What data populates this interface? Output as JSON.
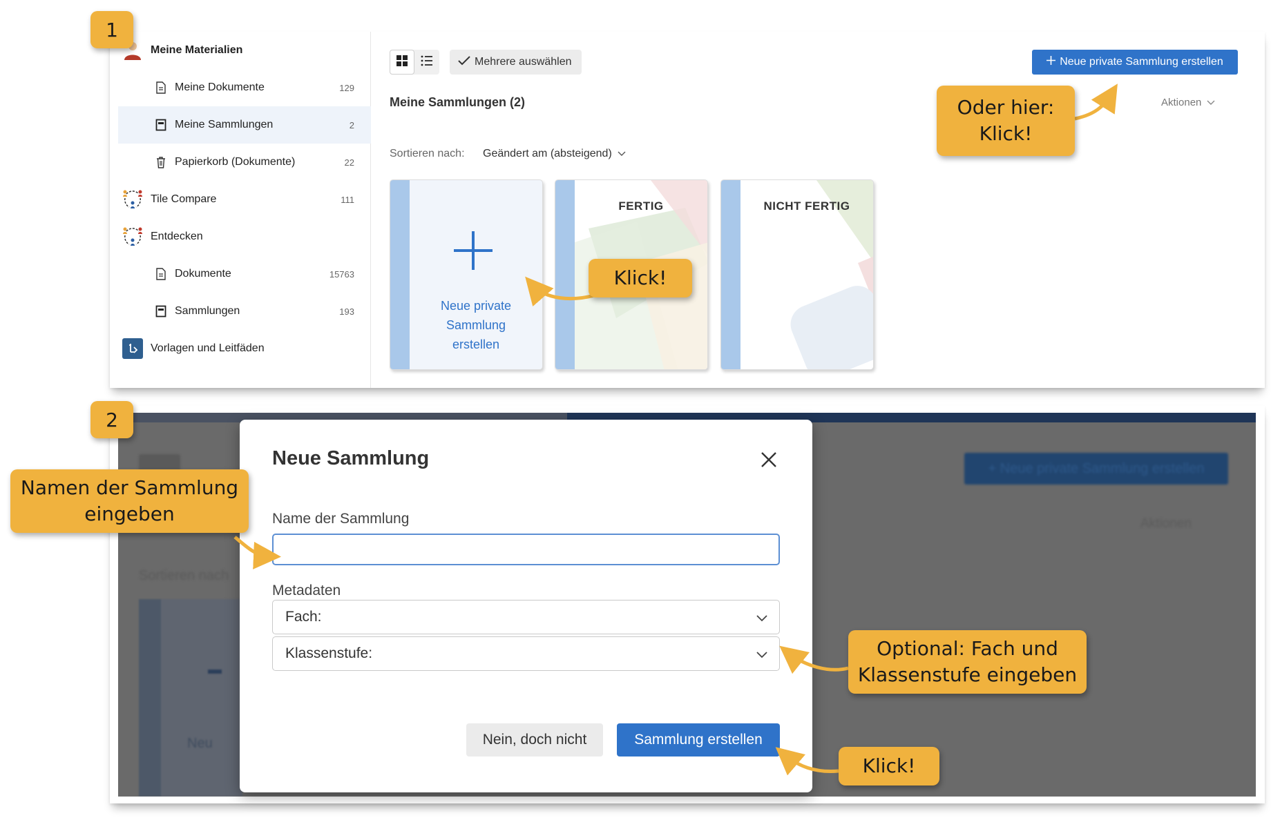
{
  "steps": {
    "one": "1",
    "two": "2"
  },
  "sidebar": {
    "items": [
      {
        "label": "Meine Materialien",
        "count": "",
        "icon": "user-avatar-icon"
      },
      {
        "label": "Meine Dokumente",
        "count": "129",
        "icon": "document-icon"
      },
      {
        "label": "Meine Sammlungen",
        "count": "2",
        "icon": "collection-icon"
      },
      {
        "label": "Papierkorb (Dokumente)",
        "count": "22",
        "icon": "trash-icon"
      },
      {
        "label": "Tile Compare",
        "count": "111",
        "icon": "community-icon"
      },
      {
        "label": "Entdecken",
        "count": "",
        "icon": "community-icon"
      },
      {
        "label": "Dokumente",
        "count": "15763",
        "icon": "document-icon"
      },
      {
        "label": "Sammlungen",
        "count": "193",
        "icon": "collection-icon"
      },
      {
        "label": "Vorlagen und Leitfäden",
        "count": "",
        "icon": "templates-logo-icon"
      }
    ]
  },
  "toolbar": {
    "select_multiple": "Mehrere auswählen",
    "new_collection": "Neue private Sammlung erstellen"
  },
  "section": {
    "title": "Meine Sammlungen (2)",
    "actions": "Aktionen",
    "sort_label": "Sortieren nach:",
    "sort_value": "Geändert am (absteigend)"
  },
  "cards": {
    "new_card_text": "Neue private Sammlung erstellen",
    "new_card_lines": [
      "Neue private",
      "Sammlung",
      "erstellen"
    ],
    "collections": [
      "FERTIG",
      "NICHT FERTIG"
    ]
  },
  "modal": {
    "title": "Neue Sammlung",
    "name_label": "Name der Sammlung",
    "name_value": "",
    "metadata_label": "Metadaten",
    "subject_select": "Fach:",
    "grade_select": "Klassenstufe:",
    "cancel": "Nein, doch nicht",
    "create": "Sammlung erstellen"
  },
  "background_blurred": {
    "new_collection_button": "+ Neue private Sammlung erstellen",
    "actions": "Aktionen",
    "sort_label": "Sortieren nach",
    "card_text": "Neu"
  },
  "annotations": {
    "or_here": [
      "Oder hier:",
      "Klick!"
    ],
    "click_card": "Klick!",
    "enter_name": [
      "Namen der Sammlung",
      "eingeben"
    ],
    "optional_meta": [
      "Optional: Fach und",
      "Klassenstufe eingeben"
    ],
    "click_create": "Klick!"
  },
  "colors": {
    "accent": "#2f73c9",
    "callout": "#f0b23e",
    "card_stripe": "#a9c8ea",
    "active_sidebar": "#eef3fa",
    "overlay": "#6a6a6a"
  }
}
